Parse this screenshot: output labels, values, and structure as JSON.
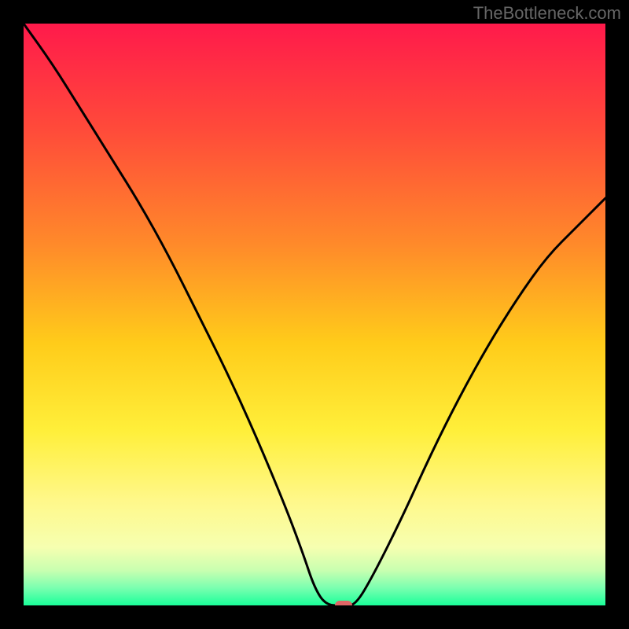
{
  "watermark": {
    "text": "TheBottleneck.com"
  },
  "chart_data": {
    "type": "line",
    "title": "",
    "xlabel": "",
    "ylabel": "",
    "xlim": [
      0,
      100
    ],
    "ylim": [
      0,
      100
    ],
    "grid": false,
    "series": [
      {
        "name": "bottleneck-curve",
        "x": [
          0,
          5,
          10,
          15,
          20,
          25,
          30,
          35,
          40,
          45,
          48,
          50,
          52,
          55,
          57,
          60,
          65,
          70,
          75,
          80,
          85,
          90,
          95,
          100
        ],
        "values": [
          100,
          93,
          85,
          77,
          69,
          60,
          50,
          40,
          29,
          17,
          9,
          3,
          0,
          0,
          0,
          5,
          15,
          26,
          36,
          45,
          53,
          60,
          65,
          70
        ]
      }
    ],
    "flat_min_range_x": [
      52,
      57
    ],
    "marker": {
      "x": 55,
      "y": 0,
      "color": "#e06666"
    },
    "background_gradient_stops": [
      {
        "pct": 0,
        "color": "#ff1a4b"
      },
      {
        "pct": 18,
        "color": "#ff4a3a"
      },
      {
        "pct": 38,
        "color": "#ff8a2a"
      },
      {
        "pct": 55,
        "color": "#ffcc1a"
      },
      {
        "pct": 70,
        "color": "#ffef3a"
      },
      {
        "pct": 82,
        "color": "#fff88a"
      },
      {
        "pct": 90,
        "color": "#f6ffb0"
      },
      {
        "pct": 94,
        "color": "#c8ffb0"
      },
      {
        "pct": 97,
        "color": "#7affb0"
      },
      {
        "pct": 100,
        "color": "#1aff9a"
      }
    ]
  }
}
